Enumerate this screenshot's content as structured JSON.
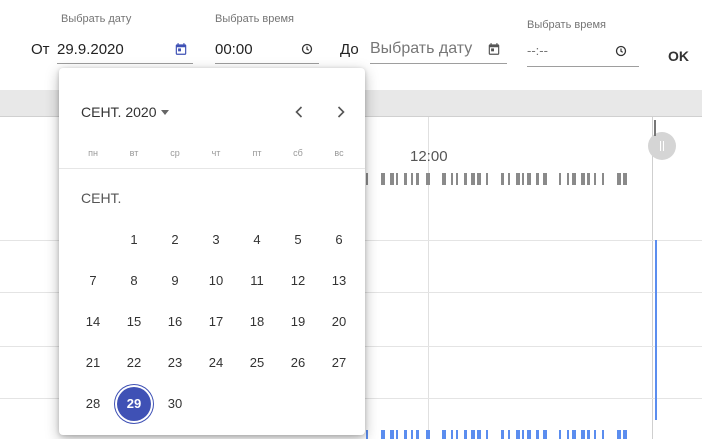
{
  "filter": {
    "from_word": "От",
    "to_word": "До",
    "from_date": {
      "label": "Выбрать дату",
      "value": "29.9.2020",
      "icon": "calendar-icon"
    },
    "from_time": {
      "label": "Выбрать время",
      "value": "00:00",
      "icon": "clock-icon"
    },
    "to_date": {
      "placeholder": "Выбрать дату",
      "icon": "calendar-icon"
    },
    "to_time": {
      "label": "Выбрать время",
      "value": "--:--",
      "icon": "clock-icon"
    },
    "ok_label": "OK"
  },
  "chart": {
    "time_label": "12:00",
    "bar_color": "#5b8def",
    "tick_color": "#8a8a8a"
  },
  "calendar": {
    "header_label": "СЕНТ. 2020",
    "month_label": "СЕНТ.",
    "weekdays": [
      "пн",
      "вт",
      "ср",
      "чт",
      "пт",
      "сб",
      "вс"
    ],
    "days": [
      "1",
      "2",
      "3",
      "4",
      "5",
      "6",
      "7",
      "8",
      "9",
      "10",
      "11",
      "12",
      "13",
      "14",
      "15",
      "16",
      "17",
      "18",
      "19",
      "20",
      "21",
      "22",
      "23",
      "24",
      "25",
      "26",
      "27",
      "28",
      "29",
      "30"
    ],
    "selected_day": "29",
    "accent_color": "#3f51b5"
  }
}
